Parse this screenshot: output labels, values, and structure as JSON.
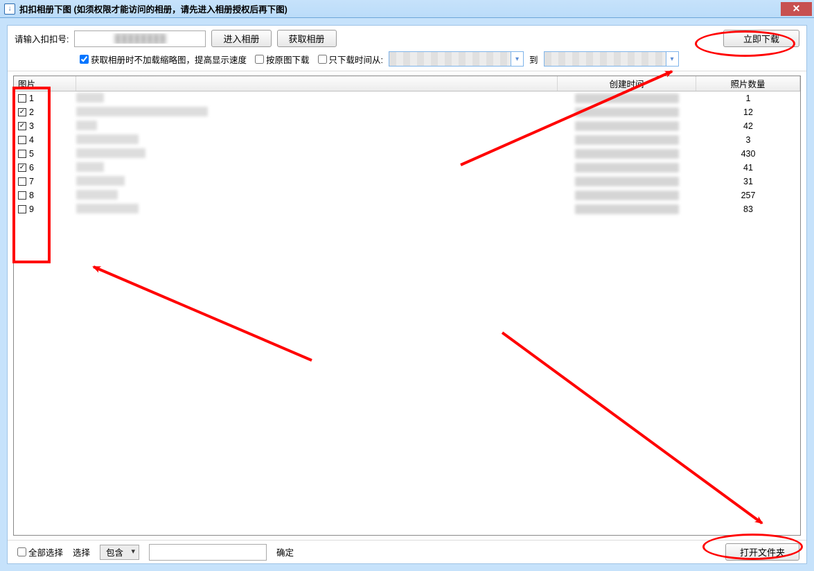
{
  "window": {
    "title": "扣扣相册下图  (如须权限才能访问的相册，请先进入相册授权后再下图)",
    "close_glyph": "✕"
  },
  "toolbar": {
    "id_label": "请输入扣扣号:",
    "enter_album_btn": "进入相册",
    "get_album_btn": "获取相册",
    "download_now_btn": "立即下载",
    "chk_nothumb_label": "获取相册时不加载缩略图，提高显示速度",
    "chk_nothumb_checked": true,
    "chk_original_label": "按原图下载",
    "chk_original_checked": false,
    "chk_daterange_label": "只下载时间从:",
    "chk_daterange_checked": false,
    "date_to_label": "到"
  },
  "columns": {
    "c0": "图片",
    "c1": "",
    "c2": "创建时间",
    "c3": "照片数量"
  },
  "rows": [
    {
      "n": "1",
      "checked": false,
      "name_width": 40,
      "count": "1"
    },
    {
      "n": "2",
      "checked": true,
      "name_width": 190,
      "count": "12"
    },
    {
      "n": "3",
      "checked": true,
      "name_width": 30,
      "count": "42"
    },
    {
      "n": "4",
      "checked": false,
      "name_width": 90,
      "count": "3"
    },
    {
      "n": "5",
      "checked": false,
      "name_width": 100,
      "count": "430"
    },
    {
      "n": "6",
      "checked": true,
      "name_width": 40,
      "count": "41"
    },
    {
      "n": "7",
      "checked": false,
      "name_width": 70,
      "count": "31"
    },
    {
      "n": "8",
      "checked": false,
      "name_width": 60,
      "count": "257"
    },
    {
      "n": "9",
      "checked": false,
      "name_width": 90,
      "count": "83"
    }
  ],
  "bottom": {
    "select_all_label": "全部选择",
    "select_all_checked": false,
    "select_label": "选择",
    "contains_option": "包含",
    "confirm_label": "确定",
    "open_folder_btn": "打开文件夹"
  }
}
